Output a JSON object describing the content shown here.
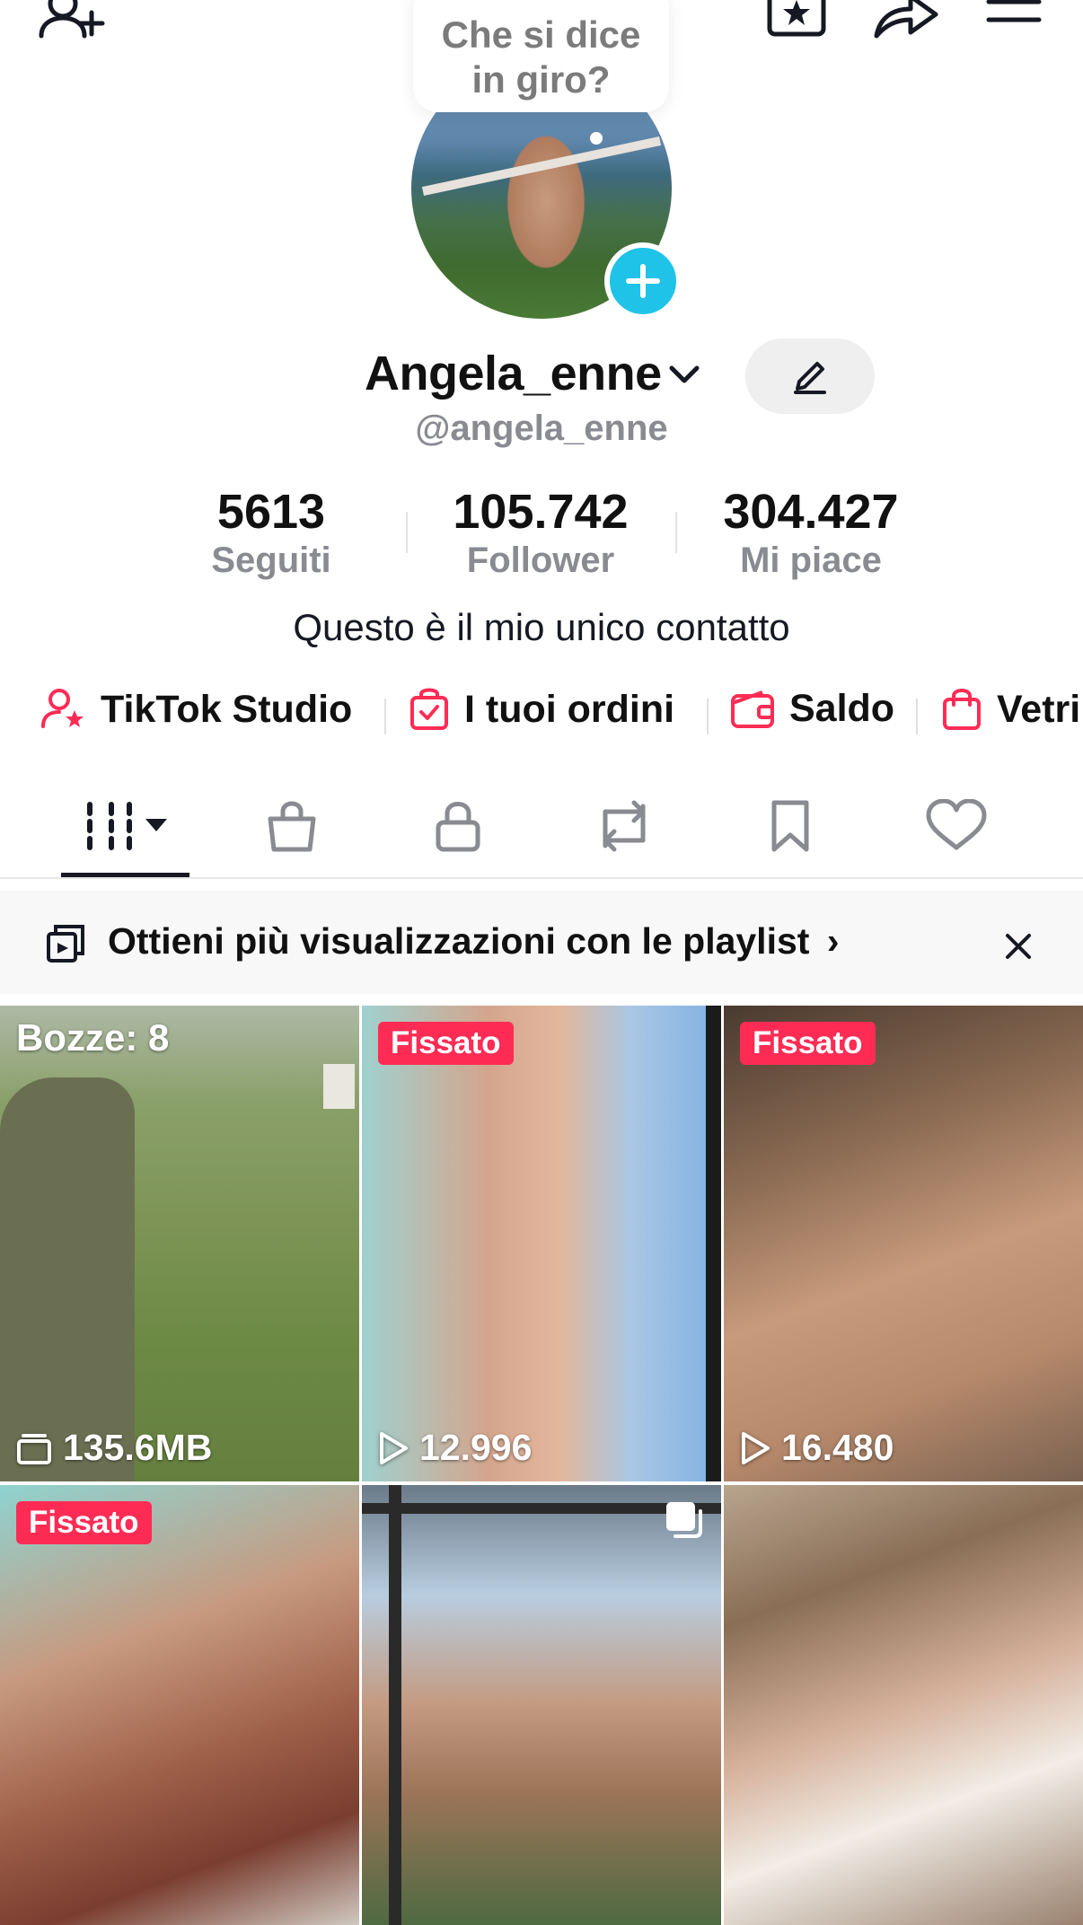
{
  "bubble": {
    "line1": "Che si dice",
    "line2": "in giro?"
  },
  "profile": {
    "display_name": "Angela_enne",
    "handle": "@angela_enne",
    "bio": "Questo è il mio unico contatto"
  },
  "stats": [
    {
      "value": "5613",
      "label": "Seguiti"
    },
    {
      "value": "105.742",
      "label": "Follower"
    },
    {
      "value": "304.427",
      "label": "Mi piace"
    }
  ],
  "shortcuts": [
    {
      "label": "TikTok Studio",
      "icon": "user-star-icon"
    },
    {
      "label": "I tuoi ordini",
      "icon": "order-bag-icon"
    },
    {
      "label": "Saldo",
      "icon": "wallet-icon"
    },
    {
      "label": "Vetri",
      "icon": "shopping-bag-icon"
    }
  ],
  "tabs": [
    {
      "icon": "grid-icon",
      "active": true
    },
    {
      "icon": "shop-bag-icon"
    },
    {
      "icon": "lock-icon"
    },
    {
      "icon": "repost-icon"
    },
    {
      "icon": "bookmark-icon"
    },
    {
      "icon": "heart-icon"
    }
  ],
  "banner": {
    "text": "Ottieni più visualizzazioni con le playlist",
    "chevron": "›"
  },
  "grid": [
    {
      "badge": "Bozze: 8",
      "count": "135.6MB",
      "count_icon": "drafts-icon"
    },
    {
      "badge": "Fissato",
      "count": "12.996",
      "count_icon": "play-icon"
    },
    {
      "badge": "Fissato",
      "count": "16.480",
      "count_icon": "play-icon"
    },
    {
      "badge": "Fissato",
      "count": "",
      "count_icon": ""
    },
    {
      "badge": "",
      "count": "",
      "count_icon": "",
      "corner_icon": "multi-photo-icon"
    },
    {
      "badge": "",
      "count": "",
      "count_icon": ""
    }
  ],
  "colors": {
    "accent_red": "#fe2c55",
    "accent_cyan": "#20c3e8",
    "text_primary": "#161823",
    "text_secondary": "#8a8b91"
  }
}
